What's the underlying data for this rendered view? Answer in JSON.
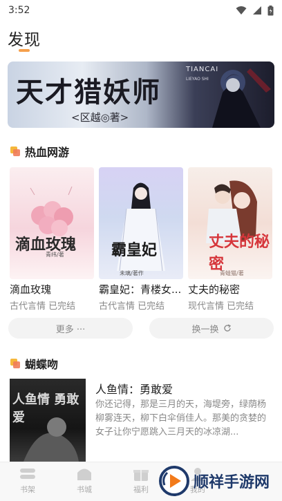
{
  "status_bar": {
    "time": "3:52"
  },
  "page": {
    "title": "发现"
  },
  "banner": {
    "title": "天才猎妖师",
    "subtitle": "<区越◎著>",
    "brand_cn": "TIANCAI",
    "brand_en": "LIEYAO SHI"
  },
  "sections": [
    {
      "title": "热血网游",
      "books": [
        {
          "title": "滴血玫瑰",
          "meta": "古代言情 已完结",
          "cover_text": "滴血玫瑰",
          "cover_author": "青纬/著"
        },
        {
          "title": "霸皇妃：青楼女...",
          "meta": "古代言情 已完结",
          "cover_text": "霸皇妃",
          "cover_author": "未璃/著作"
        },
        {
          "title": "丈夫的秘密",
          "meta": "现代言情 已完结",
          "cover_text": "丈夫的秘密",
          "cover_author": "青蛙猫/著"
        }
      ],
      "more_label": "更多 ···",
      "refresh_label": "换一换"
    },
    {
      "title": "蝴蝶吻",
      "list": [
        {
          "title": "人鱼情：勇敢爱",
          "desc": "你还记得，那是三月的天，海堤旁，绿荫杨柳雾连天，柳下白伞俏佳人。那美的贪婪的女子让你宁愿跳入三月天的冰凉湖...",
          "cover_text": "人鱼情 勇敢爱"
        }
      ]
    }
  ],
  "tabs": [
    {
      "label": "书架",
      "icon": "bookshelf-icon"
    },
    {
      "label": "书城",
      "icon": "bookstore-icon"
    },
    {
      "label": "福利",
      "icon": "gift-icon"
    },
    {
      "label": "我的",
      "icon": "profile-icon"
    }
  ],
  "watermark": {
    "text": "顺祥手游网"
  },
  "colors": {
    "accent": "#f5a04c",
    "muted_text": "#888888",
    "pill_bg": "#f3f3f3"
  }
}
